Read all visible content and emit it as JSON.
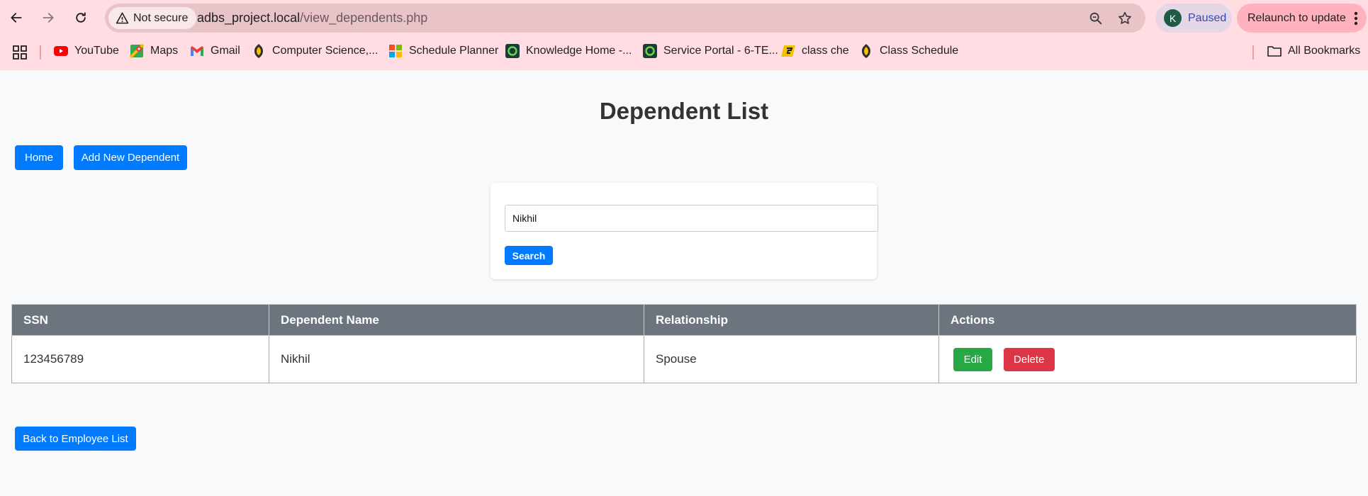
{
  "browser": {
    "security_label": "Not secure",
    "url_host": "adbs_project.local",
    "url_path": "/view_dependents.php",
    "profile_initial": "K",
    "profile_status": "Paused",
    "relaunch_label": "Relaunch to update",
    "bookmarks": [
      {
        "label": "YouTube",
        "icon": "youtube-icon"
      },
      {
        "label": "Maps",
        "icon": "maps-icon"
      },
      {
        "label": "Gmail",
        "icon": "gmail-icon"
      },
      {
        "label": "Computer Science,...",
        "icon": "school-icon"
      },
      {
        "label": "Schedule Planner",
        "icon": "windows-icon"
      },
      {
        "label": "Knowledge Home -...",
        "icon": "servicenow-icon"
      },
      {
        "label": "Service Portal - 6-TE...",
        "icon": "servicenow-icon"
      },
      {
        "label": "class che",
        "icon": "class-icon"
      },
      {
        "label": "Class Schedule",
        "icon": "school-icon"
      }
    ],
    "all_bookmarks_label": "All Bookmarks"
  },
  "page": {
    "title": "Dependent List",
    "home_button": "Home",
    "add_button": "Add New Dependent",
    "search_value": "Nikhil",
    "search_button": "Search",
    "back_button": "Back to Employee List"
  },
  "table": {
    "headers": [
      "SSN",
      "Dependent Name",
      "Relationship",
      "Actions"
    ],
    "rows": [
      {
        "ssn": "123456789",
        "name": "Nikhil",
        "relationship": "Spouse",
        "edit": "Edit",
        "delete": "Delete"
      }
    ]
  },
  "colors": {
    "primary": "#007bff",
    "success": "#28a745",
    "danger": "#dc3545",
    "table_header": "#6c757d",
    "browser_chrome": "#ffdde2"
  }
}
